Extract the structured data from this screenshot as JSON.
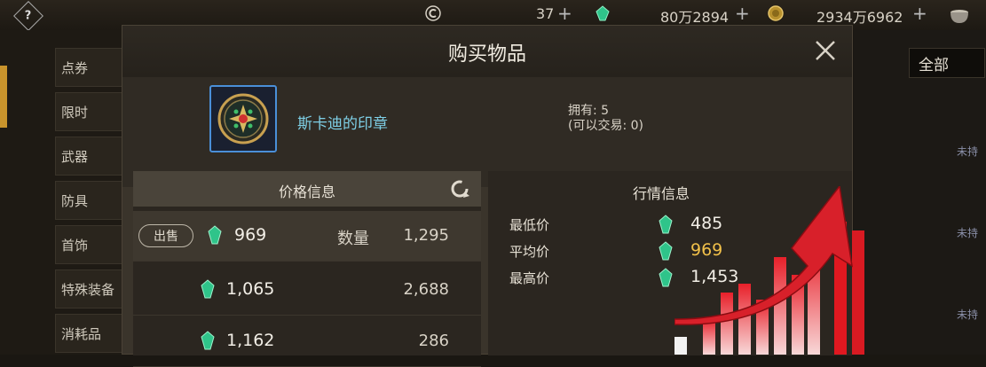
{
  "topbar": {
    "help_label": "?",
    "currency_1_value": "37",
    "currency_2_value": "80万2894",
    "currency_3_value": "2934万6962",
    "add_label": "+"
  },
  "sidebar": {
    "items": [
      {
        "label": "点券"
      },
      {
        "label": "限时"
      },
      {
        "label": "武器"
      },
      {
        "label": "防具"
      },
      {
        "label": "首饰"
      },
      {
        "label": "特殊装备"
      },
      {
        "label": "消耗品"
      }
    ]
  },
  "right_panel": {
    "filter_label": "全部",
    "untraded_label": "未持"
  },
  "modal": {
    "title": "购买物品",
    "item": {
      "name": "斯卡迪的印章",
      "owned_line1": "拥有: 5",
      "owned_line2": "(可以交易: 0)",
      "icon": "seal-medallion-icon"
    },
    "price_info": {
      "title": "价格信息",
      "sell_label": "出售",
      "quantity_label": "数量",
      "rows": [
        {
          "price": "969",
          "quantity": "1,295"
        },
        {
          "price": "1,065",
          "quantity": "2,688"
        },
        {
          "price": "1,162",
          "quantity": "286"
        }
      ]
    },
    "market_info": {
      "title": "行情信息",
      "rows": [
        {
          "label": "最低价",
          "value": "485"
        },
        {
          "label": "平均价",
          "value": "969"
        },
        {
          "label": "最高价",
          "value": "1,453"
        }
      ]
    }
  },
  "colors": {
    "item_name": "#7ecfe6",
    "average_price": "#f2c14a",
    "arrow_red": "#d8202a",
    "gem_green": "#2fc48a"
  }
}
